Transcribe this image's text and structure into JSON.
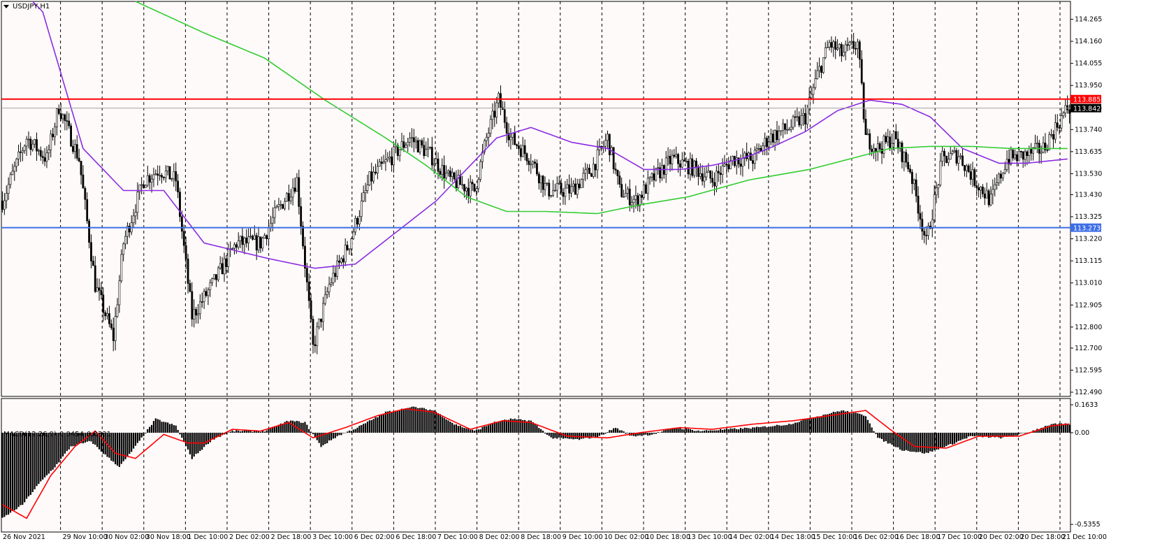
{
  "window": {
    "symbol_title": "USDJPY,H1",
    "macd_title": "MACD(12,26,9)",
    "macd_value1": "0.0454",
    "macd_value2": "0.0331"
  },
  "colors": {
    "background": "#fffafa",
    "candle": "#000000",
    "grid": "#000000",
    "ma_purple": "#8a2be2",
    "ma_green": "#32cd32",
    "resistance": "#ff0000",
    "support": "#3c6ee6",
    "macd_signal": "#ff0000",
    "macd_hist": "#000000",
    "price_tag_current": "#000000"
  },
  "chart_data": [
    {
      "type": "candlestick",
      "title": "USDJPY,H1",
      "price_axis_ticks": [
        "114.265",
        "114.160",
        "114.055",
        "113.950",
        "113.845",
        "113.740",
        "113.635",
        "113.530",
        "113.430",
        "113.325",
        "113.220",
        "113.115",
        "113.010",
        "112.905",
        "112.800",
        "112.700",
        "112.595",
        "112.490"
      ],
      "time_axis_labels": [
        "26 Nov 2021",
        "29 Nov 10:00",
        "30 Nov 02:00",
        "30 Nov 18:00",
        "1 Dec 10:00",
        "2 Dec 02:00",
        "2 Dec 18:00",
        "3 Dec 10:00",
        "6 Dec 02:00",
        "6 Dec 18:00",
        "7 Dec 10:00",
        "8 Dec 02:00",
        "8 Dec 18:00",
        "9 Dec 10:00",
        "10 Dec 02:00",
        "10 Dec 18:00",
        "13 Dec 10:00",
        "14 Dec 02:00",
        "14 Dec 18:00",
        "15 Dec 10:00",
        "16 Dec 02:00",
        "16 Dec 18:00",
        "17 Dec 10:00",
        "20 Dec 02:00",
        "20 Dec 18:00",
        "21 Dec 10:00"
      ],
      "ylim": [
        112.47,
        114.35
      ],
      "grid": "vertical dashed",
      "horizontal_lines": [
        {
          "name": "resistance",
          "value": 113.885,
          "label": "113.885"
        },
        {
          "name": "support",
          "value": 113.273,
          "label": "113.273"
        }
      ],
      "current_price": {
        "value": 113.842,
        "label": "113.842"
      },
      "path_anchors": [
        [
          0,
          113.4
        ],
        [
          12,
          113.7
        ],
        [
          22,
          113.6
        ],
        [
          28,
          113.85
        ],
        [
          38,
          113.6
        ],
        [
          46,
          113.0
        ],
        [
          55,
          112.75
        ],
        [
          60,
          113.2
        ],
        [
          70,
          113.5
        ],
        [
          78,
          113.55
        ],
        [
          86,
          113.5
        ],
        [
          94,
          112.85
        ],
        [
          104,
          113.0
        ],
        [
          116,
          113.2
        ],
        [
          128,
          113.2
        ],
        [
          136,
          113.35
        ],
        [
          146,
          113.5
        ],
        [
          154,
          112.7
        ],
        [
          162,
          113.0
        ],
        [
          172,
          113.2
        ],
        [
          182,
          113.5
        ],
        [
          192,
          113.6
        ],
        [
          202,
          113.7
        ],
        [
          212,
          113.62
        ],
        [
          222,
          113.5
        ],
        [
          234,
          113.45
        ],
        [
          240,
          113.7
        ],
        [
          246,
          113.88
        ],
        [
          252,
          113.7
        ],
        [
          262,
          113.6
        ],
        [
          270,
          113.45
        ],
        [
          282,
          113.45
        ],
        [
          292,
          113.55
        ],
        [
          300,
          113.7
        ],
        [
          306,
          113.45
        ],
        [
          314,
          113.4
        ],
        [
          322,
          113.5
        ],
        [
          332,
          113.6
        ],
        [
          344,
          113.55
        ],
        [
          352,
          113.5
        ],
        [
          362,
          113.6
        ],
        [
          372,
          113.6
        ],
        [
          380,
          113.7
        ],
        [
          390,
          113.75
        ],
        [
          398,
          113.8
        ],
        [
          404,
          114.0
        ],
        [
          410,
          114.15
        ],
        [
          416,
          114.1
        ],
        [
          424,
          114.15
        ],
        [
          428,
          113.7
        ],
        [
          434,
          113.65
        ],
        [
          442,
          113.7
        ],
        [
          450,
          113.55
        ],
        [
          458,
          113.2
        ],
        [
          466,
          113.6
        ],
        [
          474,
          113.62
        ],
        [
          482,
          113.5
        ],
        [
          490,
          113.4
        ],
        [
          498,
          113.6
        ],
        [
          508,
          113.62
        ],
        [
          516,
          113.65
        ],
        [
          524,
          113.78
        ],
        [
          528,
          113.842
        ]
      ],
      "series": [
        {
          "name": "MA purple",
          "anchors": [
            [
              0,
              114.5
            ],
            [
              20,
              114.3
            ],
            [
              40,
              113.65
            ],
            [
              60,
              113.45
            ],
            [
              80,
              113.45
            ],
            [
              100,
              113.2
            ],
            [
              130,
              113.13
            ],
            [
              155,
              113.08
            ],
            [
              175,
              113.1
            ],
            [
              195,
              113.25
            ],
            [
              215,
              113.4
            ],
            [
              230,
              113.55
            ],
            [
              245,
              113.7
            ],
            [
              262,
              113.75
            ],
            [
              282,
              113.68
            ],
            [
              300,
              113.65
            ],
            [
              318,
              113.55
            ],
            [
              336,
              113.55
            ],
            [
              352,
              113.57
            ],
            [
              366,
              113.6
            ],
            [
              380,
              113.65
            ],
            [
              398,
              113.73
            ],
            [
              414,
              113.83
            ],
            [
              430,
              113.88
            ],
            [
              446,
              113.86
            ],
            [
              460,
              113.8
            ],
            [
              476,
              113.65
            ],
            [
              494,
              113.58
            ],
            [
              508,
              113.58
            ],
            [
              528,
              113.6
            ]
          ]
        },
        {
          "name": "MA green",
          "anchors": [
            [
              66,
              114.35
            ],
            [
              100,
              114.2
            ],
            [
              130,
              114.08
            ],
            [
              160,
              113.88
            ],
            [
              190,
              113.7
            ],
            [
              210,
              113.57
            ],
            [
              230,
              113.42
            ],
            [
              250,
              113.35
            ],
            [
              270,
              113.35
            ],
            [
              295,
              113.34
            ],
            [
              315,
              113.38
            ],
            [
              340,
              113.42
            ],
            [
              370,
              113.5
            ],
            [
              400,
              113.55
            ],
            [
              420,
              113.6
            ],
            [
              440,
              113.65
            ],
            [
              460,
              113.66
            ],
            [
              480,
              113.66
            ],
            [
              500,
              113.65
            ],
            [
              528,
              113.65
            ]
          ]
        }
      ]
    },
    {
      "type": "bar",
      "title": "MACD(12,26,9)",
      "ylabel_ticks": [
        "0.1633",
        "0.00",
        "-0.5355"
      ],
      "ylim": [
        -0.58,
        0.2
      ],
      "hist_anchors": [
        [
          0,
          -0.5
        ],
        [
          10,
          -0.42
        ],
        [
          18,
          -0.3
        ],
        [
          26,
          -0.2
        ],
        [
          34,
          -0.08
        ],
        [
          44,
          -0.05
        ],
        [
          50,
          -0.12
        ],
        [
          58,
          -0.2
        ],
        [
          66,
          -0.08
        ],
        [
          76,
          0.08
        ],
        [
          86,
          0.04
        ],
        [
          94,
          -0.15
        ],
        [
          104,
          -0.04
        ],
        [
          114,
          0.01
        ],
        [
          130,
          0.01
        ],
        [
          142,
          0.07
        ],
        [
          150,
          0.06
        ],
        [
          158,
          -0.08
        ],
        [
          166,
          -0.02
        ],
        [
          176,
          0.03
        ],
        [
          190,
          0.12
        ],
        [
          204,
          0.15
        ],
        [
          214,
          0.13
        ],
        [
          224,
          0.05
        ],
        [
          234,
          0.01
        ],
        [
          244,
          0.06
        ],
        [
          252,
          0.08
        ],
        [
          262,
          0.07
        ],
        [
          272,
          -0.03
        ],
        [
          286,
          -0.04
        ],
        [
          296,
          -0.02
        ],
        [
          304,
          0.03
        ],
        [
          312,
          -0.02
        ],
        [
          322,
          -0.01
        ],
        [
          334,
          0.03
        ],
        [
          346,
          0.01
        ],
        [
          360,
          0.02
        ],
        [
          374,
          0.03
        ],
        [
          390,
          0.05
        ],
        [
          402,
          0.09
        ],
        [
          416,
          0.13
        ],
        [
          428,
          0.1
        ],
        [
          434,
          -0.03
        ],
        [
          446,
          -0.1
        ],
        [
          458,
          -0.12
        ],
        [
          470,
          -0.07
        ],
        [
          480,
          -0.02
        ],
        [
          496,
          -0.03
        ],
        [
          508,
          0.0
        ],
        [
          520,
          0.05
        ],
        [
          528,
          0.05
        ]
      ],
      "signal_anchors": [
        [
          0,
          -0.42
        ],
        [
          12,
          -0.5
        ],
        [
          24,
          -0.25
        ],
        [
          36,
          -0.08
        ],
        [
          46,
          0.01
        ],
        [
          56,
          -0.12
        ],
        [
          66,
          -0.15
        ],
        [
          80,
          -0.01
        ],
        [
          92,
          -0.06
        ],
        [
          100,
          -0.06
        ],
        [
          114,
          0.02
        ],
        [
          128,
          0.01
        ],
        [
          142,
          0.06
        ],
        [
          154,
          -0.03
        ],
        [
          170,
          0.03
        ],
        [
          186,
          0.1
        ],
        [
          200,
          0.14
        ],
        [
          214,
          0.12
        ],
        [
          232,
          0.02
        ],
        [
          248,
          0.07
        ],
        [
          262,
          0.06
        ],
        [
          280,
          -0.02
        ],
        [
          300,
          -0.03
        ],
        [
          316,
          0.0
        ],
        [
          336,
          0.03
        ],
        [
          352,
          0.02
        ],
        [
          372,
          0.05
        ],
        [
          392,
          0.07
        ],
        [
          410,
          0.1
        ],
        [
          428,
          0.13
        ],
        [
          440,
          0.02
        ],
        [
          452,
          -0.08
        ],
        [
          468,
          -0.09
        ],
        [
          484,
          -0.02
        ],
        [
          504,
          -0.02
        ],
        [
          520,
          0.04
        ],
        [
          528,
          0.05
        ]
      ]
    }
  ]
}
